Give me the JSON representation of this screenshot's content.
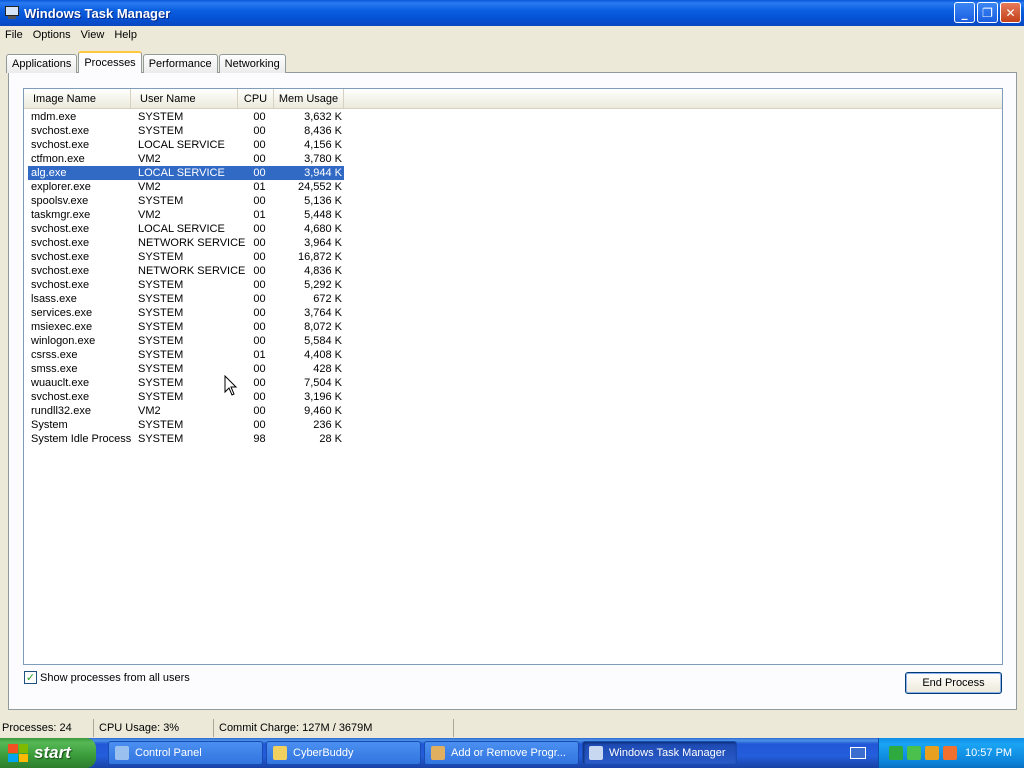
{
  "window": {
    "title": "Windows Task Manager"
  },
  "window_buttons": {
    "minimize": "_",
    "maximize": "❐",
    "close": "✕"
  },
  "menu": [
    "File",
    "Options",
    "View",
    "Help"
  ],
  "tabs": [
    "Applications",
    "Processes",
    "Performance",
    "Networking"
  ],
  "active_tab": "Processes",
  "columns": {
    "name": "Image Name",
    "user": "User Name",
    "cpu": "CPU",
    "mem": "Mem Usage"
  },
  "processes": [
    {
      "name": "mdm.exe",
      "user": "SYSTEM",
      "cpu": "00",
      "mem": "3,632 K"
    },
    {
      "name": "svchost.exe",
      "user": "SYSTEM",
      "cpu": "00",
      "mem": "8,436 K"
    },
    {
      "name": "svchost.exe",
      "user": "LOCAL SERVICE",
      "cpu": "00",
      "mem": "4,156 K"
    },
    {
      "name": "ctfmon.exe",
      "user": "VM2",
      "cpu": "00",
      "mem": "3,780 K"
    },
    {
      "name": "alg.exe",
      "user": "LOCAL SERVICE",
      "cpu": "00",
      "mem": "3,944 K",
      "selected": true
    },
    {
      "name": "explorer.exe",
      "user": "VM2",
      "cpu": "01",
      "mem": "24,552 K"
    },
    {
      "name": "spoolsv.exe",
      "user": "SYSTEM",
      "cpu": "00",
      "mem": "5,136 K"
    },
    {
      "name": "taskmgr.exe",
      "user": "VM2",
      "cpu": "01",
      "mem": "5,448 K"
    },
    {
      "name": "svchost.exe",
      "user": "LOCAL SERVICE",
      "cpu": "00",
      "mem": "4,680 K"
    },
    {
      "name": "svchost.exe",
      "user": "NETWORK SERVICE",
      "cpu": "00",
      "mem": "3,964 K"
    },
    {
      "name": "svchost.exe",
      "user": "SYSTEM",
      "cpu": "00",
      "mem": "16,872 K"
    },
    {
      "name": "svchost.exe",
      "user": "NETWORK SERVICE",
      "cpu": "00",
      "mem": "4,836 K"
    },
    {
      "name": "svchost.exe",
      "user": "SYSTEM",
      "cpu": "00",
      "mem": "5,292 K"
    },
    {
      "name": "lsass.exe",
      "user": "SYSTEM",
      "cpu": "00",
      "mem": "672 K"
    },
    {
      "name": "services.exe",
      "user": "SYSTEM",
      "cpu": "00",
      "mem": "3,764 K"
    },
    {
      "name": "msiexec.exe",
      "user": "SYSTEM",
      "cpu": "00",
      "mem": "8,072 K"
    },
    {
      "name": "winlogon.exe",
      "user": "SYSTEM",
      "cpu": "00",
      "mem": "5,584 K"
    },
    {
      "name": "csrss.exe",
      "user": "SYSTEM",
      "cpu": "01",
      "mem": "4,408 K"
    },
    {
      "name": "smss.exe",
      "user": "SYSTEM",
      "cpu": "00",
      "mem": "428 K"
    },
    {
      "name": "wuauclt.exe",
      "user": "SYSTEM",
      "cpu": "00",
      "mem": "7,504 K"
    },
    {
      "name": "svchost.exe",
      "user": "SYSTEM",
      "cpu": "00",
      "mem": "3,196 K"
    },
    {
      "name": "rundll32.exe",
      "user": "VM2",
      "cpu": "00",
      "mem": "9,460 K"
    },
    {
      "name": "System",
      "user": "SYSTEM",
      "cpu": "00",
      "mem": "236 K"
    },
    {
      "name": "System Idle Process",
      "user": "SYSTEM",
      "cpu": "98",
      "mem": "28 K"
    }
  ],
  "show_all_users": {
    "label": "Show processes from all users",
    "checked": true,
    "check_glyph": "✓"
  },
  "end_process_label": "End Process",
  "status": {
    "processes": "Processes: 24",
    "cpu": "CPU Usage: 3%",
    "commit": "Commit Charge: 127M / 3679M"
  },
  "taskbar": {
    "start_label": "start",
    "tasks": [
      {
        "label": "Control Panel",
        "color": "#9ac0f0"
      },
      {
        "label": "CyberBuddy",
        "color": "#f2d060"
      },
      {
        "label": "Add or Remove Progr...",
        "color": "#e0b060"
      },
      {
        "label": "Windows Task Manager",
        "color": "#c8d8f0",
        "active": true
      }
    ],
    "clock": "10:57 PM"
  }
}
